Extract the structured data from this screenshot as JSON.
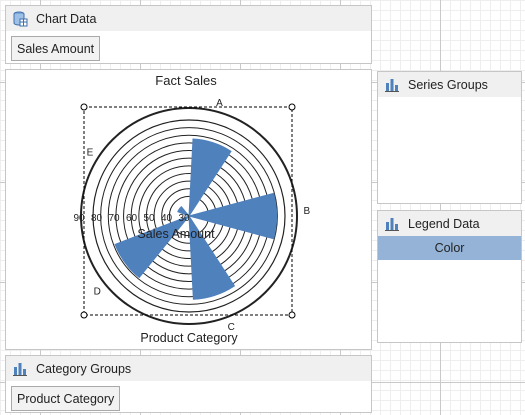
{
  "chart_data_panel": {
    "title": "Chart Data",
    "field": "Sales Amount"
  },
  "series_groups": {
    "title": "Series Groups"
  },
  "legend_data": {
    "title": "Legend Data",
    "row": "Color"
  },
  "category_groups": {
    "title": "Category Groups",
    "field": "Product Category"
  },
  "chart": {
    "title": "Fact Sales",
    "axis_label": "Product Category",
    "value_label": "Sales Amount",
    "chart_data": {
      "type": "polar",
      "title": "Fact Sales",
      "xlabel": "Product Category",
      "ylabel": "Sales Amount",
      "categories": [
        "A",
        "B",
        "C",
        "D",
        "E"
      ],
      "values": [
        82,
        92,
        88,
        84,
        20
      ],
      "radial_ticks": [
        "90",
        "80",
        "70",
        "60",
        "50",
        "40",
        "30"
      ],
      "ylim": [
        20,
        100
      ],
      "fill_color": "#4f81bd"
    }
  }
}
